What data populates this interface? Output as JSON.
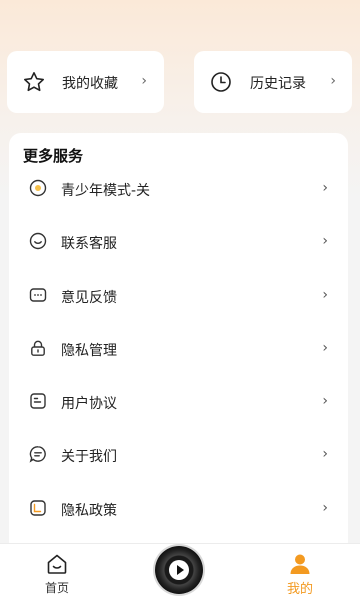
{
  "quick_links": {
    "favorites": {
      "label": "我的收藏",
      "icon": "star-icon",
      "chevron": "›"
    },
    "history": {
      "label": "历史记录",
      "icon": "clock-icon",
      "chevron": "›"
    }
  },
  "services": {
    "title": "更多服务",
    "items": [
      {
        "label": "青少年模式-关",
        "icon": "teen-mode-icon",
        "chevron": "›"
      },
      {
        "label": "联系客服",
        "icon": "smile-icon",
        "chevron": "›"
      },
      {
        "label": "意见反馈",
        "icon": "feedback-icon",
        "chevron": "›"
      },
      {
        "label": "隐私管理",
        "icon": "lock-icon",
        "chevron": "›"
      },
      {
        "label": "用户协议",
        "icon": "document-icon",
        "chevron": "›"
      },
      {
        "label": "关于我们",
        "icon": "chat-icon",
        "chevron": "›"
      },
      {
        "label": "隐私政策",
        "icon": "policy-icon",
        "chevron": "›"
      }
    ]
  },
  "tabbar": {
    "home": {
      "label": "首页",
      "icon": "home-icon"
    },
    "play": {
      "icon": "play-icon"
    },
    "mine": {
      "label": "我的",
      "icon": "user-icon"
    }
  },
  "colors": {
    "accent": "#f39a21",
    "card": "#ffffff",
    "background": "#f4f4f4"
  }
}
